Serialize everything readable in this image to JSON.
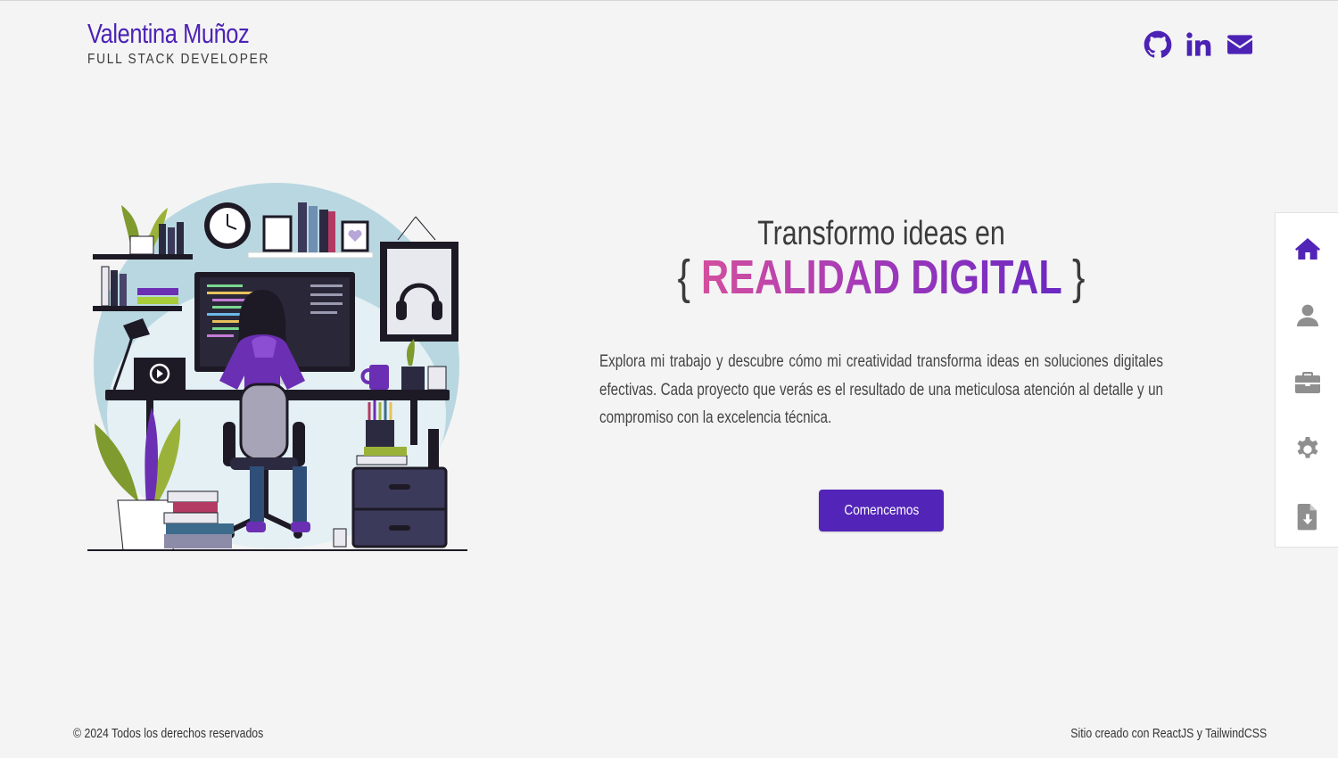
{
  "header": {
    "name": "Valentina Muñoz",
    "role": "FULL STACK DEVELOPER",
    "social": [
      {
        "name": "github-icon",
        "label": "GitHub"
      },
      {
        "name": "linkedin-icon",
        "label": "LinkedIn"
      },
      {
        "name": "email-icon",
        "label": "Email"
      }
    ]
  },
  "hero": {
    "line1": "Transformo ideas en",
    "brace_open": "{",
    "highlight": "REALIDAD DIGITAL",
    "brace_close": "}",
    "description": "Explora mi trabajo y descubre cómo mi creatividad transforma ideas en soluciones digitales efectivas. Cada proyecto que verás es el resultado de una meticulosa atención al detalle y un compromiso con la excelencia técnica.",
    "cta_label": "Comencemos"
  },
  "sidenav": {
    "items": [
      {
        "icon": "home-icon",
        "active": true
      },
      {
        "icon": "user-icon",
        "active": false
      },
      {
        "icon": "briefcase-icon",
        "active": false
      },
      {
        "icon": "gear-icon",
        "active": false
      },
      {
        "icon": "file-download-icon",
        "active": false
      }
    ]
  },
  "footer": {
    "copyright": "© 2024 Todos los derechos reservados",
    "credits": "Sitio creado con ReactJS y TailwindCSS"
  },
  "colors": {
    "accent": "#5225b8",
    "brand_text": "#4c22b5",
    "gradient_start": "#d34f9e",
    "gradient_end": "#6a28c2",
    "icon_inactive": "#8f8f8f"
  }
}
